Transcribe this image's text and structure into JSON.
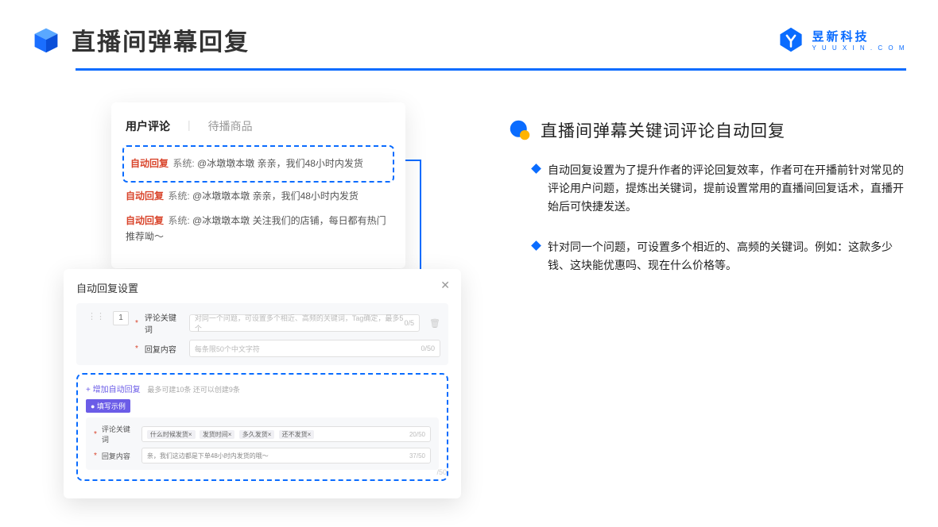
{
  "header": {
    "title": "直播间弹幕回复"
  },
  "brand": {
    "cn": "昱新科技",
    "en": "Y U U X I N . C O M"
  },
  "comments": {
    "tabs": {
      "active": "用户评论",
      "other": "待播商品"
    },
    "rows": [
      {
        "label": "自动回复",
        "prefix": "系统:",
        "text": "@冰墩墩本墩 亲亲，我们48小时内发货"
      },
      {
        "label": "自动回复",
        "prefix": "系统:",
        "text": "@冰墩墩本墩 亲亲，我们48小时内发货"
      },
      {
        "label": "自动回复",
        "prefix": "系统:",
        "text": "@冰墩墩本墩 关注我们的店铺，每日都有热门推荐呦～"
      }
    ]
  },
  "settings": {
    "title": "自动回复设置",
    "index": "1",
    "fields": {
      "kw_label": "评论关键词",
      "kw_ph": "对同一个问题，可设置多个相近、高频的关键词，Tag确定，最多5个",
      "kw_cnt": "0/5",
      "reply_label": "回复内容",
      "reply_ph": "每条限50个中文字符",
      "reply_cnt": "0/50"
    },
    "example": {
      "add_link": "+ 增加自动回复",
      "add_hint": "最多可建10条 还可以创建9条",
      "badge": "● 填写示例",
      "kw_label": "评论关键词",
      "tags": [
        "什么时候发货×",
        "发货时间×",
        "多久发货×",
        "还不发货×"
      ],
      "kw_cnt": "20/50",
      "reply_label": "回复内容",
      "reply_text": "亲，我们这边都是下单48小时内发货的哦～",
      "reply_cnt": "37/50"
    },
    "ghost_cnt": "/50"
  },
  "right": {
    "section_title": "直播间弹幕关键词评论自动回复",
    "bullets": [
      "自动回复设置为了提升作者的评论回复效率，作者可在开播前针对常见的评论用户问题，提炼出关键词，提前设置常用的直播间回复话术，直播开始后可快捷发送。",
      "针对同一个问题，可设置多个相近的、高频的关键词。例如：这款多少钱、这块能优惠吗、现在什么价格等。"
    ]
  }
}
